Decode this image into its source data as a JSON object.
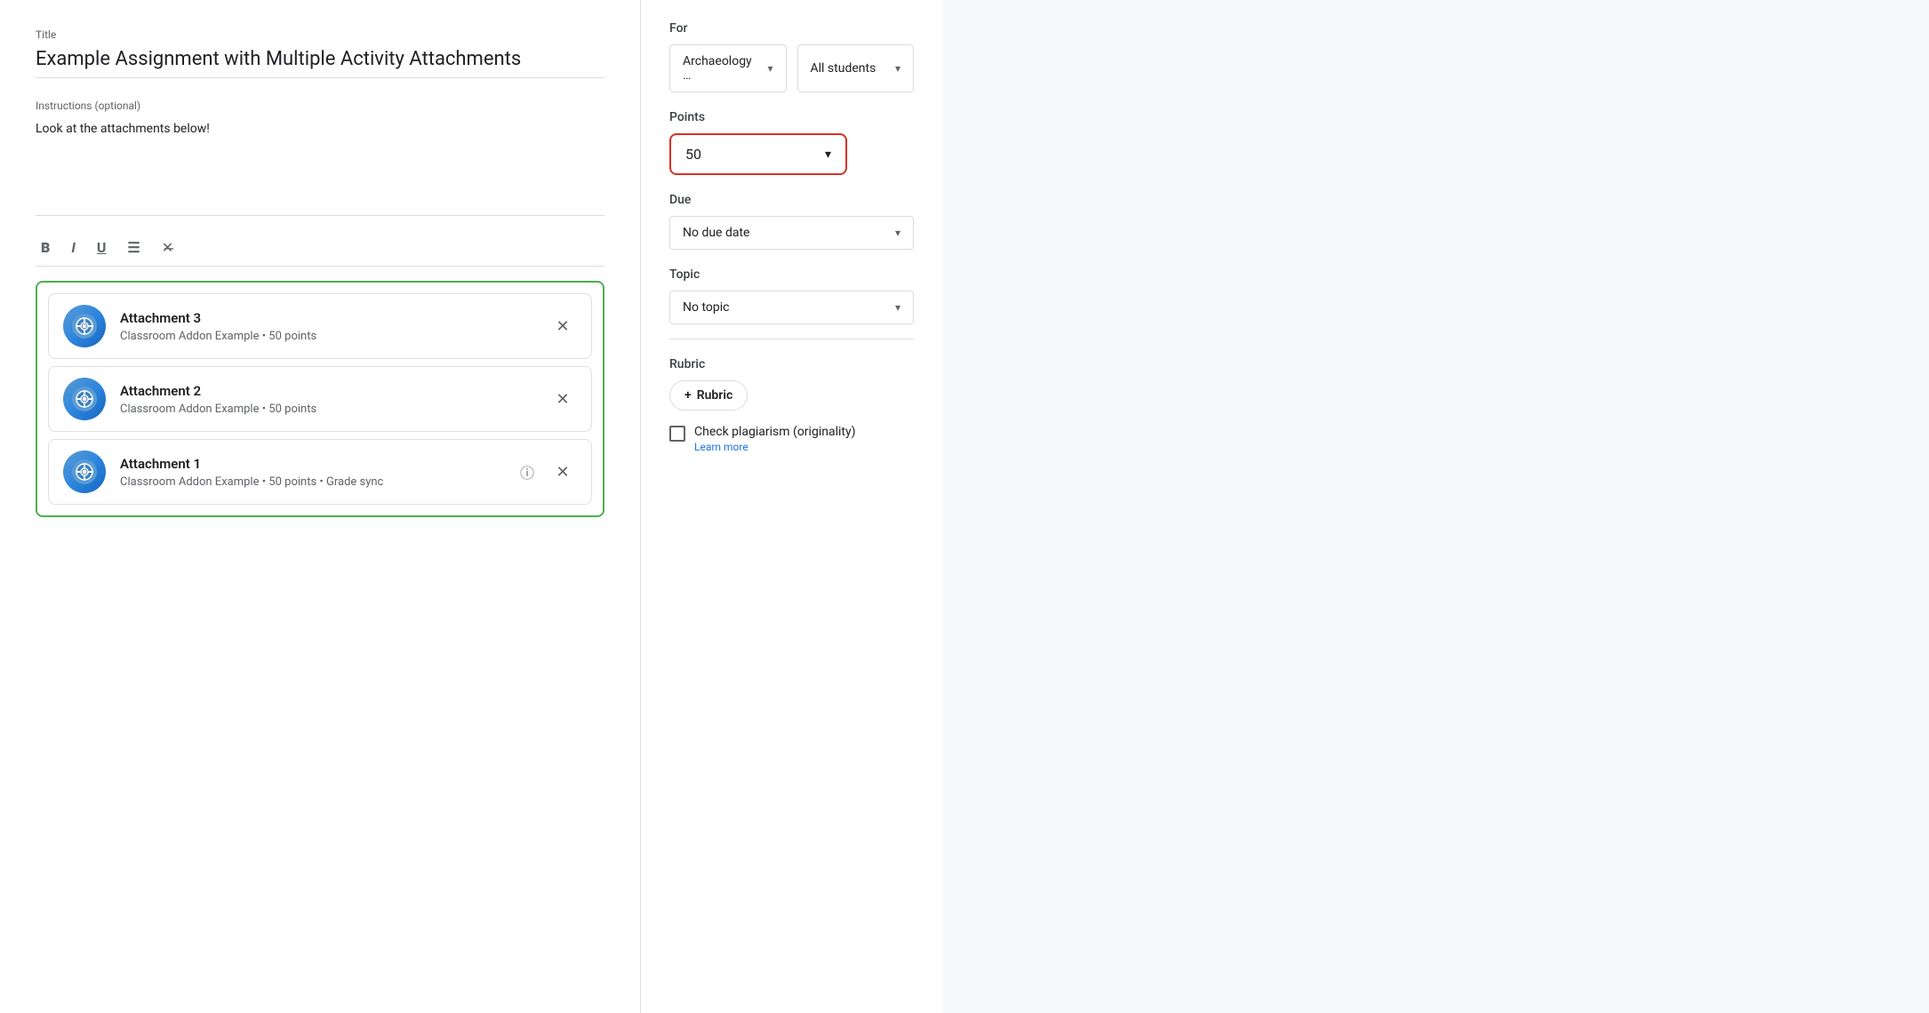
{
  "main": {
    "title_label": "Title",
    "title_value": "Example Assignment with Multiple Activity Attachments",
    "instructions_label": "Instructions (optional)",
    "instructions_value": "Look at the attachments below!",
    "toolbar": {
      "bold": "B",
      "italic": "I",
      "underline": "U",
      "list": "≡",
      "clear": "✕̶"
    },
    "attachments": [
      {
        "name": "Attachment 3",
        "meta": "Classroom Addon Example • 50 points",
        "has_info": false
      },
      {
        "name": "Attachment 2",
        "meta": "Classroom Addon Example • 50 points",
        "has_info": false
      },
      {
        "name": "Attachment 1",
        "meta": "Classroom Addon Example • 50 points • Grade sync",
        "has_info": true
      }
    ]
  },
  "sidebar": {
    "for_label": "For",
    "class_value": "Archaeology …",
    "students_value": "All students",
    "points_label": "Points",
    "points_value": "50",
    "due_label": "Due",
    "due_value": "No due date",
    "topic_label": "Topic",
    "topic_value": "No topic",
    "rubric_label": "Rubric",
    "rubric_btn": "Rubric",
    "plus_icon": "+",
    "plagiarism_label": "Check plagiarism (originality)",
    "learn_more": "Learn more",
    "chevron": "▾"
  }
}
